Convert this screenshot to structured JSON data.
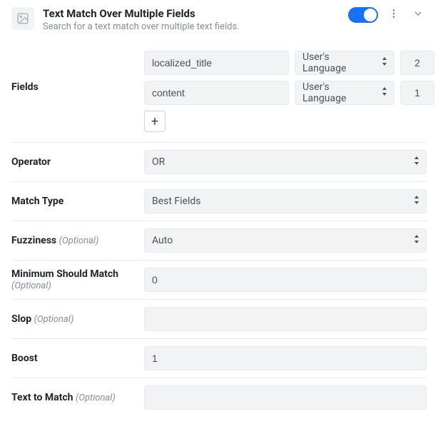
{
  "header": {
    "title": "Text Match Over Multiple Fields",
    "description": "Search for a text match over multiple text fields."
  },
  "fields": {
    "label": "Fields",
    "rows": [
      {
        "name": "localized_title",
        "lang": "User's Language",
        "weight": "2"
      },
      {
        "name": "content",
        "lang": "User's Language",
        "weight": "1"
      }
    ]
  },
  "operator": {
    "label": "Operator",
    "value": "OR"
  },
  "matchType": {
    "label": "Match Type",
    "value": "Best Fields"
  },
  "fuzziness": {
    "label": "Fuzziness",
    "optional": "(Optional)",
    "value": "Auto"
  },
  "minShould": {
    "label": "Minimum Should Match",
    "optional": "(Optional)",
    "value": "0"
  },
  "slop": {
    "label": "Slop",
    "optional": "(Optional)",
    "value": ""
  },
  "boost": {
    "label": "Boost",
    "value": "1"
  },
  "textToMatch": {
    "label": "Text to Match",
    "optional": "(Optional)",
    "value": ""
  }
}
